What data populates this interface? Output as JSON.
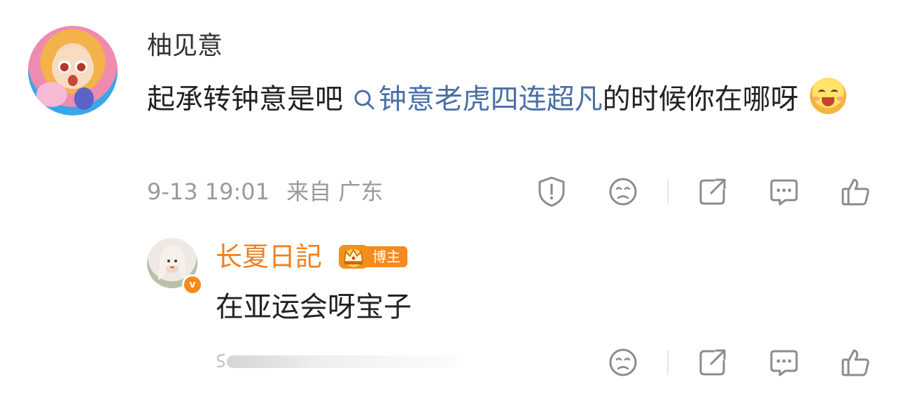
{
  "comment": {
    "username": "柚见意",
    "text_before": "起承转钟意是吧",
    "topic": "钟意老虎四连超凡",
    "text_after": "的时候你在哪呀",
    "emoji": "happy-blush-emoji",
    "timestamp": "9-13 19:01",
    "source": "来自 广东",
    "actions": [
      "report-icon",
      "dislike-icon",
      "share-icon",
      "reply-icon",
      "like-icon"
    ]
  },
  "reply": {
    "username": "长夏日記",
    "badge_label": "博主",
    "verified_mark": "v",
    "text": "在亚运会呀宝子",
    "actions": [
      "dislike-icon",
      "share-icon",
      "reply-icon",
      "like-icon"
    ]
  },
  "colors": {
    "topic_link": "#4a6fa5",
    "blogger_orange": "#f58a1f",
    "meta_gray": "#9a9a9a",
    "icon_gray": "#8c8c8c"
  }
}
